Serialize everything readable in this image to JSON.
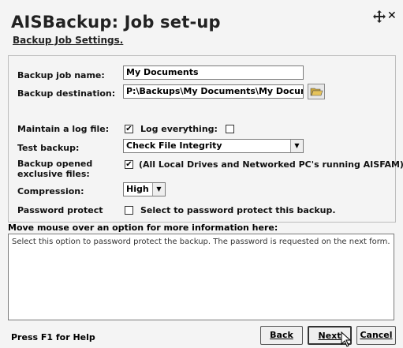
{
  "window": {
    "title": "AISBackup: Job set-up",
    "subtitle": "Backup Job Settings."
  },
  "form": {
    "job_name_label": "Backup job name:",
    "job_name_value": "My Documents",
    "destination_label": "Backup destination:",
    "destination_value": "P:\\Backups\\My Documents\\My Docume",
    "log_label": "Maintain a log file:",
    "log_checked": "✔",
    "log_everything_label": "Log everything:",
    "test_label": "Test backup:",
    "test_value": "Check File Integrity",
    "exclusive_label_1": "Backup opened",
    "exclusive_label_2": "exclusive files:",
    "exclusive_checked": "✔",
    "exclusive_text": "(All Local Drives and Networked PC's running AISFAM)",
    "compression_label": "Compression:",
    "compression_value": "High",
    "password_label": "Password protect",
    "password_text": "Select to password protect this backup."
  },
  "help": {
    "heading": "Move mouse over an option for more information here:",
    "text": "Select this option to password protect the backup. The password is requested on the next form."
  },
  "footer": {
    "help_hint": "Press F1 for Help",
    "back_label": "Back",
    "next_label": "Next",
    "cancel_label": "Cancel"
  },
  "icons": {
    "move": "move-icon",
    "close": "close-icon",
    "browse": "folder-open-icon",
    "dropdown": "chevron-down-icon"
  }
}
